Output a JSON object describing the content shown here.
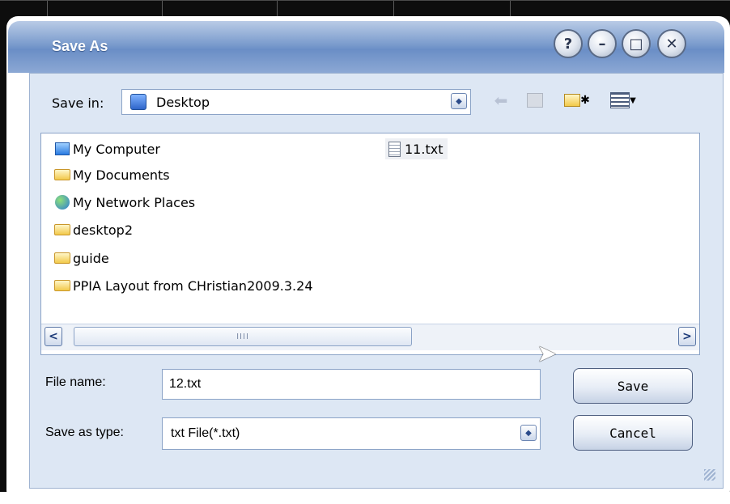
{
  "window": {
    "title": "Save As",
    "controls": {
      "help": "?",
      "minimize": "–",
      "maximize": "□",
      "close": "✕"
    }
  },
  "save_in": {
    "label": "Save in:",
    "value": "Desktop",
    "icon": "desktop-icon"
  },
  "toolbar": {
    "icons": [
      "back-arrow-icon",
      "up-folder-icon",
      "new-folder-icon",
      "view-menu-icon"
    ]
  },
  "files": [
    {
      "name": "My Computer",
      "icon": "my-computer-icon"
    },
    {
      "name": "My Documents",
      "icon": "my-documents-icon"
    },
    {
      "name": "My Network Places",
      "icon": "network-places-icon"
    },
    {
      "name": "desktop2",
      "icon": "folder-icon"
    },
    {
      "name": "guide",
      "icon": "folder-icon"
    },
    {
      "name": "PPIA Layout from CHristian2009.3.24",
      "icon": "folder-icon"
    },
    {
      "name": "11.txt",
      "icon": "text-file-icon"
    }
  ],
  "scrollbar": {
    "thumb_grip": "IIII",
    "left": "<",
    "right": ">"
  },
  "file_name": {
    "label": "File name:",
    "value": "12.txt"
  },
  "save_as_type": {
    "label": "Save as type:",
    "value": "txt File(*.txt)"
  },
  "buttons": {
    "save": "Save",
    "cancel": "Cancel"
  },
  "colors": {
    "title_bar": "#7b9ccd",
    "panel": "#dde7f4",
    "border": "#8ba3c7"
  }
}
